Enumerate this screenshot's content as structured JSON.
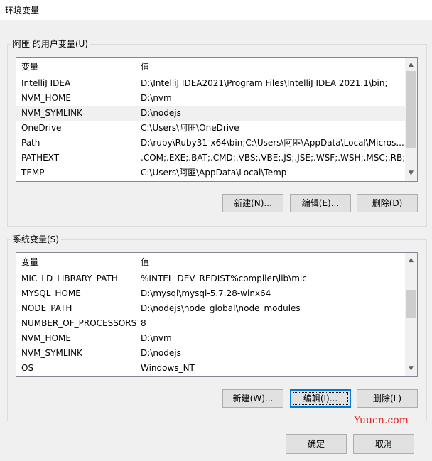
{
  "window": {
    "title": "环境变量"
  },
  "user_vars": {
    "legend": "阿匪 的用户变量(U)",
    "columns": [
      "变量",
      "值"
    ],
    "rows": [
      {
        "name": "IntelliJ IDEA",
        "value": "D:\\IntelliJ IDEA2021\\Program Files\\IntelliJ IDEA 2021.1\\bin;"
      },
      {
        "name": "NVM_HOME",
        "value": "D:\\nvm"
      },
      {
        "name": "NVM_SYMLINK",
        "value": "D:\\nodejs"
      },
      {
        "name": "OneDrive",
        "value": "C:\\Users\\阿匪\\OneDrive"
      },
      {
        "name": "Path",
        "value": "D:\\ruby\\Ruby31-x64\\bin;C:\\Users\\阿匪\\AppData\\Local\\Micros..."
      },
      {
        "name": "PATHEXT",
        "value": ".COM;.EXE;.BAT;.CMD;.VBS;.VBE;.JS;.JSE;.WSF;.WSH;.MSC;.RB;...."
      },
      {
        "name": "TEMP",
        "value": "C:\\Users\\阿匪\\AppData\\Local\\Temp"
      }
    ],
    "selected_index": 2,
    "buttons": {
      "new": "新建(N)...",
      "edit": "编辑(E)...",
      "delete": "删除(D)"
    }
  },
  "system_vars": {
    "legend": "系统变量(S)",
    "columns": [
      "变量",
      "值"
    ],
    "rows": [
      {
        "name": "MIC_LD_LIBRARY_PATH",
        "value": "%INTEL_DEV_REDIST%compiler\\lib\\mic"
      },
      {
        "name": "MYSQL_HOME",
        "value": "D:\\mysql\\mysql-5.7.28-winx64"
      },
      {
        "name": "NODE_PATH",
        "value": "D:\\nodejs\\node_global\\node_modules"
      },
      {
        "name": "NUMBER_OF_PROCESSORS",
        "value": "8"
      },
      {
        "name": "NVM_HOME",
        "value": "D:\\nvm"
      },
      {
        "name": "NVM_SYMLINK",
        "value": "D:\\nodejs"
      },
      {
        "name": "OS",
        "value": "Windows_NT"
      }
    ],
    "buttons": {
      "new": "新建(W)...",
      "edit": "编辑(I)...",
      "delete": "删除(L)"
    }
  },
  "dialog_buttons": {
    "ok": "确定",
    "cancel": "取消"
  },
  "watermark": "Yuucn.com",
  "colors": {
    "focus": "#0078d7",
    "watermark": "#e2231a",
    "selected_row": "#f0f0f0"
  }
}
